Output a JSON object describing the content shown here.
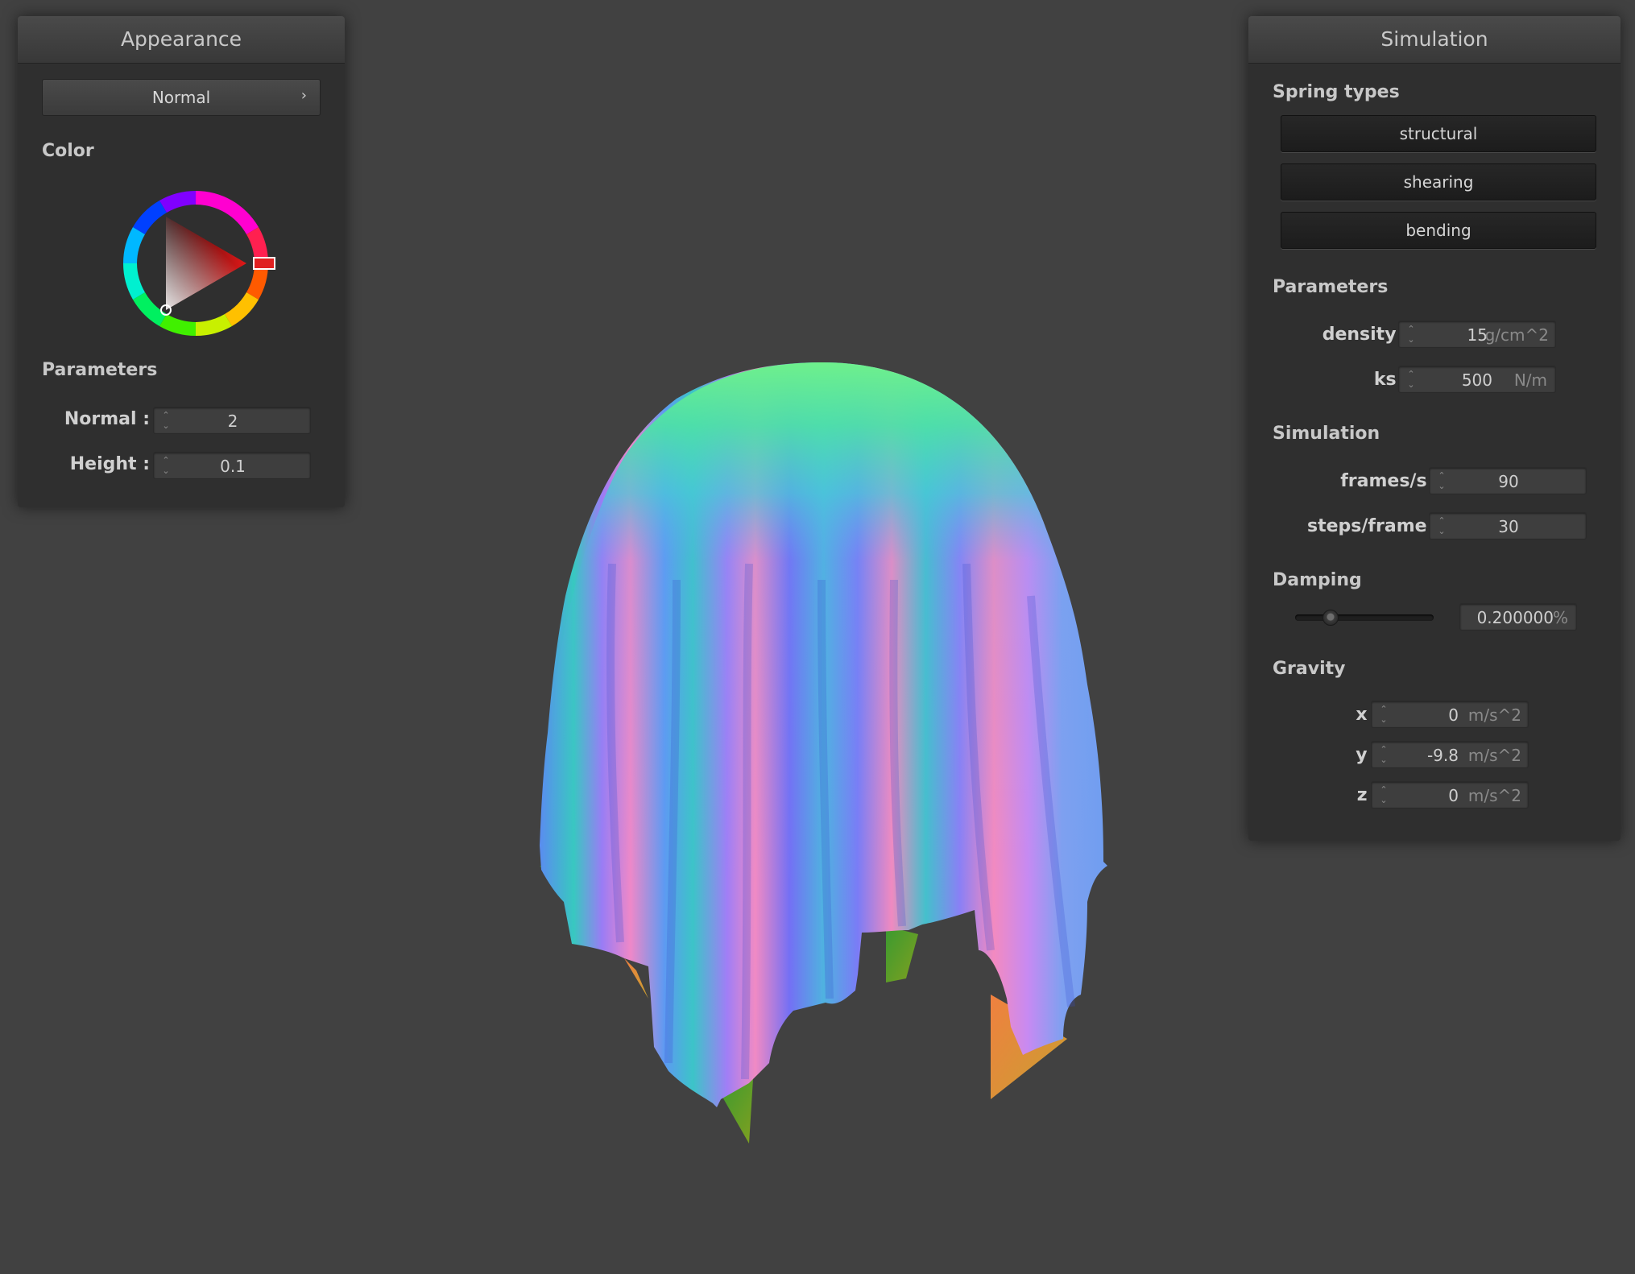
{
  "appearance": {
    "title": "Appearance",
    "shader_select": "Normal",
    "color_label": "Color",
    "params_label": "Parameters",
    "normal_label": "Normal :",
    "normal_value": "2",
    "height_label": "Height :",
    "height_value": "0.1",
    "color_hex": "#e02020"
  },
  "simulation": {
    "title": "Simulation",
    "spring_types_label": "Spring types",
    "springs": [
      "structural",
      "shearing",
      "bending"
    ],
    "parameters_label": "Parameters",
    "density_label": "density :",
    "density_value": "15",
    "density_unit": "g/cm^2",
    "ks_label": "ks :",
    "ks_value": "500",
    "ks_unit": "N/m",
    "simulation_label": "Simulation",
    "fps_label": "frames/s :",
    "fps_value": "90",
    "steps_label": "steps/frame :",
    "steps_value": "30",
    "damping_label": "Damping",
    "damping_value": "0.200000",
    "damping_unit": "%",
    "damping_slider_fraction": 0.2,
    "gravity_label": "Gravity",
    "gx_label": "x :",
    "gx_value": "0",
    "gy_label": "y :",
    "gy_value": "-9.8",
    "gz_label": "z :",
    "gz_value": "0",
    "gravity_unit": "m/s^2"
  },
  "viewport": {
    "object": "cloth-draped-sphere",
    "shading": "normal"
  },
  "colors": {
    "background": "#414141",
    "panel": "#2f2f2f"
  }
}
